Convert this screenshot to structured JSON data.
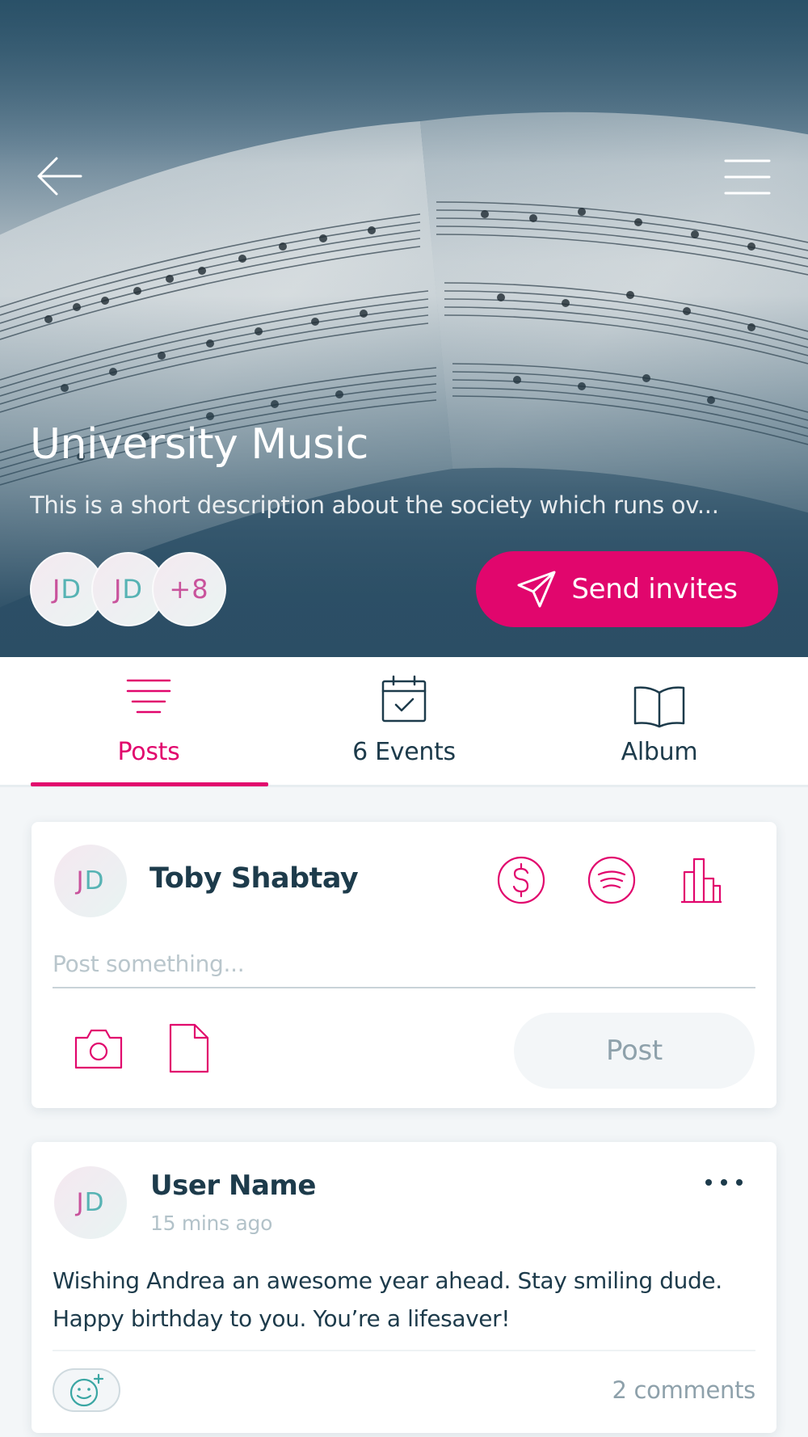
{
  "hero": {
    "title": "University Music",
    "description": "This is a short description about the society which runs ov...",
    "members": [
      {
        "initials_1": "J",
        "initials_2": "D"
      },
      {
        "initials_1": "J",
        "initials_2": "D"
      }
    ],
    "more_members": "+8",
    "send_invites_label": "Send invites",
    "icons": {
      "back": "arrow-left-icon",
      "menu": "hamburger-menu-icon",
      "send": "paper-plane-icon"
    }
  },
  "tabs": [
    {
      "label": "Posts",
      "icon": "list-lines-icon",
      "active": true
    },
    {
      "label": "6 Events",
      "icon": "calendar-check-icon",
      "active": false
    },
    {
      "label": "Album",
      "icon": "open-book-icon",
      "active": false
    }
  ],
  "composer": {
    "avatar": {
      "initials_1": "J",
      "initials_2": "D"
    },
    "name": "Toby Shabtay",
    "tools": [
      "dollar-circle-icon",
      "spotify-icon",
      "bar-chart-icon"
    ],
    "placeholder": "Post something...",
    "attachments": [
      "camera-icon",
      "file-icon"
    ],
    "post_label": "Post"
  },
  "post": {
    "avatar": {
      "initials_1": "J",
      "initials_2": "D"
    },
    "author": "User Name",
    "time": "15 mins ago",
    "body": "Wishing Andrea an awesome year ahead. Stay smiling dude. Happy birthday to you. You’re a lifesaver!",
    "comments_label": "2 comments",
    "icons": {
      "more": "more-dots-icon",
      "react": "add-emoji-icon"
    }
  },
  "colors": {
    "accent": "#e1066d",
    "text": "#1d3b4b",
    "hero": "#2b4e65",
    "muted": "#8ea1ab"
  }
}
